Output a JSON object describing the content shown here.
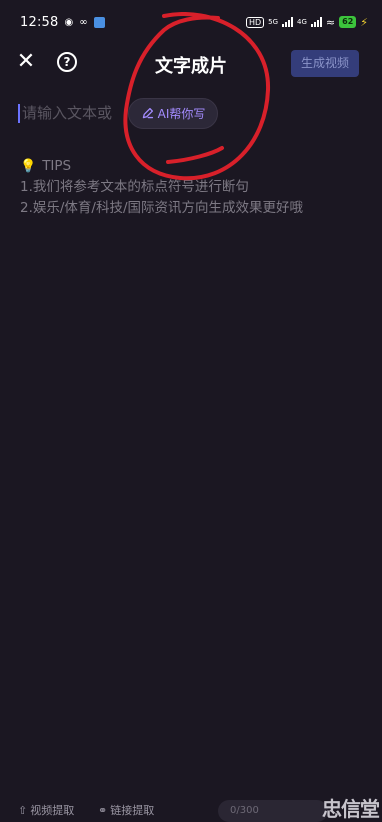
{
  "status_bar": {
    "time": "12:58",
    "hd_label": "HD",
    "net_5g": "5G",
    "net_4g": "4G",
    "battery": "62",
    "icons": [
      "owl-icon",
      "infinity-icon",
      "app-square-icon",
      "signal-icon",
      "wifi-icon",
      "battery-icon",
      "charging-bolt-icon"
    ]
  },
  "header": {
    "title": "文字成片",
    "generate_button": "生成视频",
    "close_icon": "close-icon",
    "help_icon": "help-circle-icon"
  },
  "editor": {
    "placeholder": "请输入文本或",
    "ai_button": "AI帮你写"
  },
  "tips": {
    "heading": "TIPS",
    "line1": "1.我们将参考文本的标点符号进行断句",
    "line2": "2.娱乐/体育/科技/国际资讯方向生成效果更好哦"
  },
  "bottom_bar": {
    "item1": "视频提取",
    "item2": "链接提取",
    "pill": "0/300"
  },
  "watermark": "忠信堂",
  "colors": {
    "background": "#1b1722",
    "accent": "#a48cff",
    "button_bg": "#343d7a",
    "annotation": "#d8202a"
  }
}
